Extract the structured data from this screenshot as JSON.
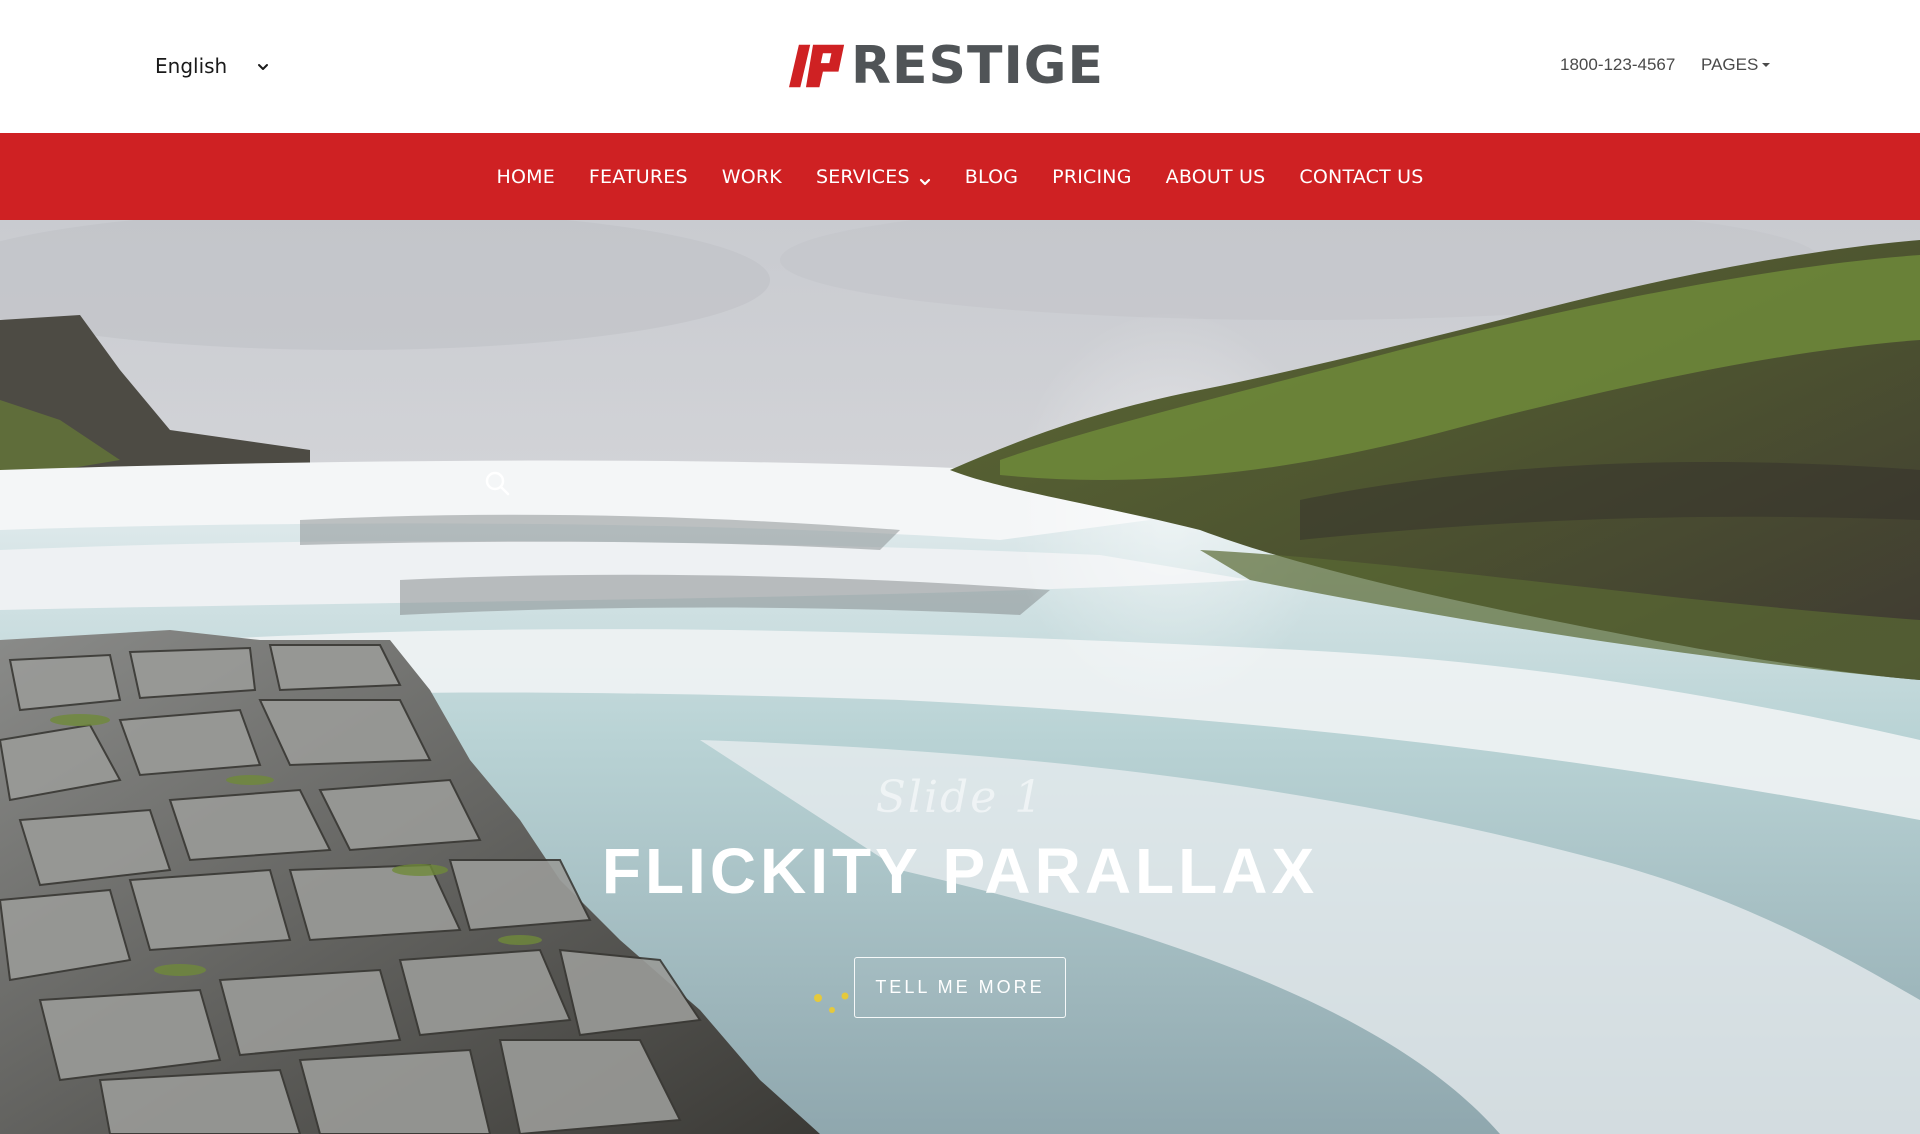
{
  "colors": {
    "accent": "#cf2123",
    "logo_text": "#505457",
    "white": "#ffffff"
  },
  "topbar": {
    "language": {
      "selected": "English",
      "icon": "chevron-down-icon"
    },
    "logo": {
      "mark": "P",
      "text": "RESTIGE"
    },
    "phone": "1800-123-4567",
    "pages_label": "PAGES"
  },
  "nav": {
    "items": [
      {
        "label": "HOME"
      },
      {
        "label": "FEATURES"
      },
      {
        "label": "WORK"
      },
      {
        "label": "SERVICES",
        "has_dropdown": true
      },
      {
        "label": "BLOG"
      },
      {
        "label": "PRICING"
      },
      {
        "label": "ABOUT US"
      },
      {
        "label": "CONTACT US"
      }
    ]
  },
  "hero": {
    "search_icon": "search-icon",
    "subtitle": "Slide 1",
    "title": "FLICKITY PARALLAX",
    "cta_label": "TELL ME MORE"
  }
}
